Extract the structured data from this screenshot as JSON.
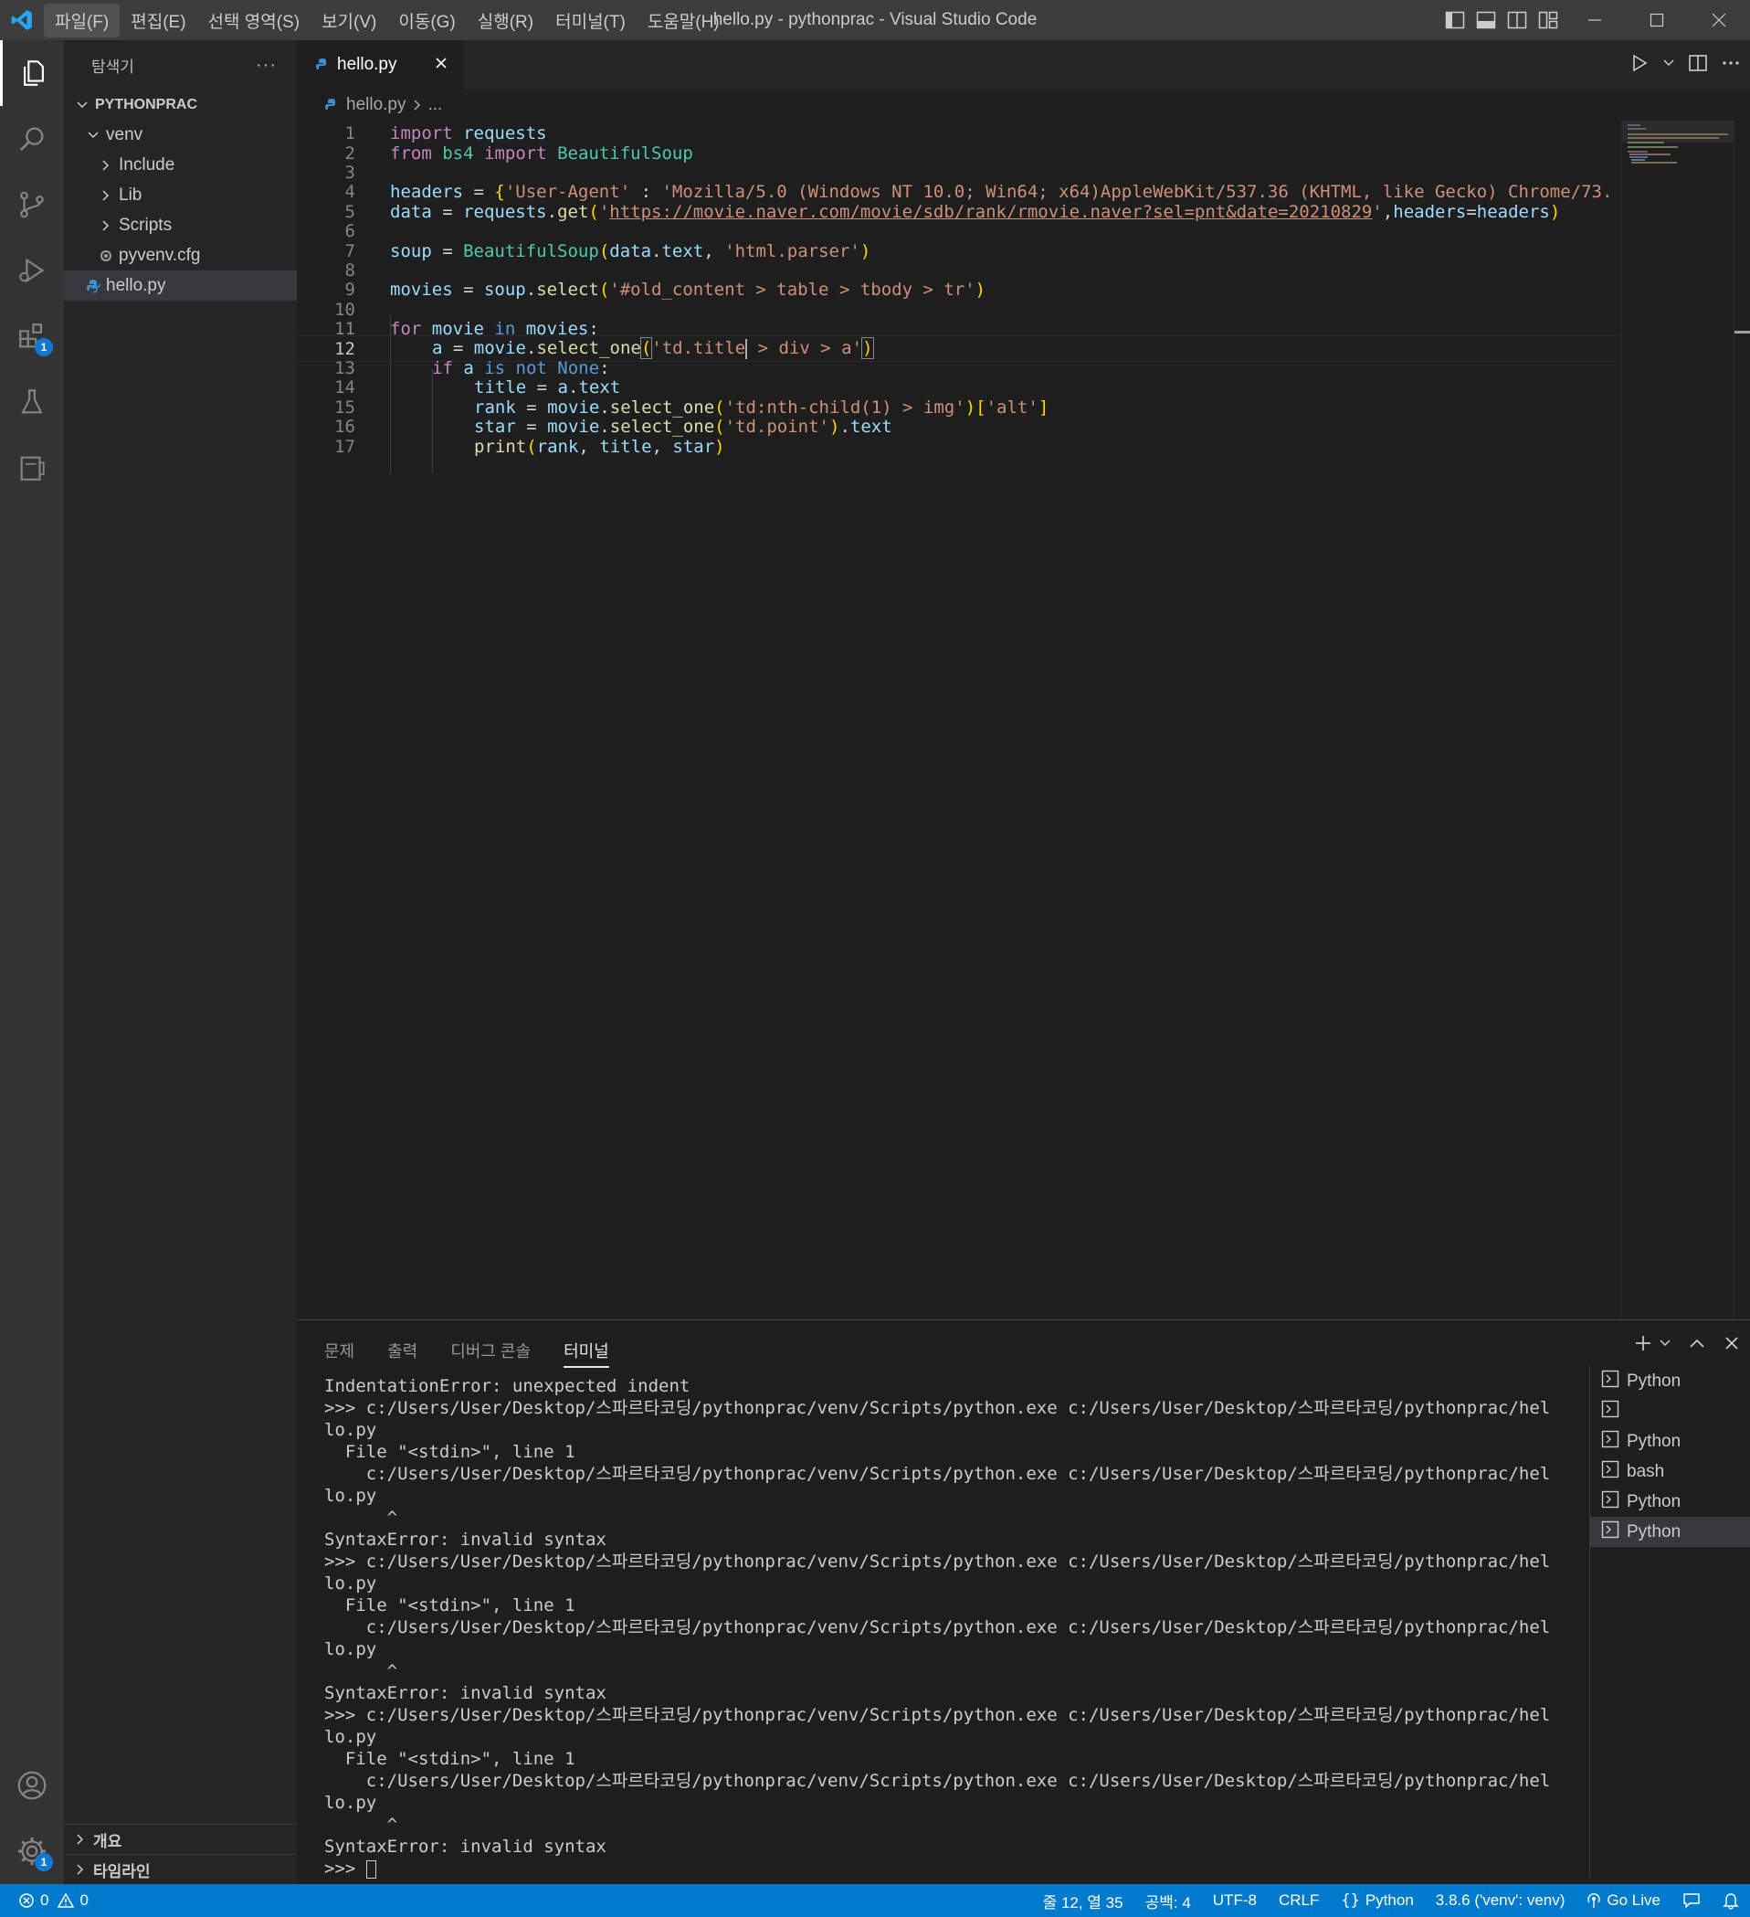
{
  "window": {
    "title": "hello.py - pythonprac - Visual Studio Code",
    "menu": [
      "파일(F)",
      "편집(E)",
      "선택 영역(S)",
      "보기(V)",
      "이동(G)",
      "실행(R)",
      "터미널(T)",
      "도움말(H)"
    ]
  },
  "activity_bar": {
    "extensions_badge": "1",
    "settings_badge": "1"
  },
  "sidebar": {
    "title": "탐색기",
    "more": "···",
    "project": "PYTHONPRAC",
    "items": [
      {
        "label": "venv"
      },
      {
        "label": "Include"
      },
      {
        "label": "Lib"
      },
      {
        "label": "Scripts"
      },
      {
        "label": "pyvenv.cfg"
      },
      {
        "label": "hello.py"
      }
    ],
    "outline": "개요",
    "timeline": "타임라인"
  },
  "editor": {
    "tab_label": "hello.py",
    "breadcrumb_file": "hello.py",
    "breadcrumb_rest": "...",
    "line_numbers": [
      "1",
      "2",
      "3",
      "4",
      "5",
      "6",
      "7",
      "8",
      "9",
      "10",
      "11",
      "12",
      "13",
      "14",
      "15",
      "16",
      "17"
    ],
    "lines": {
      "l1_a": "import",
      "l1_b": "requests",
      "l2_a": "from",
      "l2_b": "bs4",
      "l2_c": "import",
      "l2_d": "BeautifulSoup",
      "l4_a": "headers",
      "l4_b": " = ",
      "l4_c": "{",
      "l4_d": "'User-Agent'",
      "l4_e": " : ",
      "l4_f": "'Mozilla/5.0 (Windows NT 10.0; Win64; x64)AppleWebKit/537.36 (KHTML, like Gecko) Chrome/73.",
      "l5_a": "data",
      "l5_b": " = ",
      "l5_c": "requests",
      "l5_d": ".",
      "l5_e": "get",
      "l5_f": "(",
      "l5_g": "'",
      "l5_h": "https://movie.naver.com/movie/sdb/rank/rmovie.naver?sel=pnt&date=20210829",
      "l5_i": "'",
      "l5_j": ",",
      "l5_k": "headers",
      "l5_l": "=",
      "l5_m": "headers",
      "l5_n": ")",
      "l7_a": "soup",
      "l7_b": " = ",
      "l7_c": "BeautifulSoup",
      "l7_d": "(",
      "l7_e": "data",
      "l7_f": ".",
      "l7_g": "text",
      "l7_h": ", ",
      "l7_i": "'html.parser'",
      "l7_j": ")",
      "l9_a": "movies",
      "l9_b": " = ",
      "l9_c": "soup",
      "l9_d": ".",
      "l9_e": "select",
      "l9_f": "(",
      "l9_g": "'#old_content > table > tbody > tr'",
      "l9_h": ")",
      "l11_a": "for",
      "l11_b": " movie ",
      "l11_c": "in",
      "l11_d": " movies",
      "l11_e": ":",
      "l12_a": "a",
      "l12_b": " = ",
      "l12_c": "movie",
      "l12_d": ".",
      "l12_e": "select_one",
      "l12_f": "(",
      "l12_g": "'td.title",
      "l12_h": " > div > a'",
      "l12_i": ")",
      "l13_a": "if",
      "l13_b": " a ",
      "l13_c": "is not",
      "l13_d": " None",
      "l13_e": ":",
      "l14_a": "title",
      "l14_b": " = ",
      "l14_c": "a",
      "l14_d": ".",
      "l14_e": "text",
      "l15_a": "rank",
      "l15_b": " = ",
      "l15_c": "movie",
      "l15_d": ".",
      "l15_e": "select_one",
      "l15_f": "(",
      "l15_g": "'td:nth-child(1) > img'",
      "l15_h": ")",
      "l15_i": "[",
      "l15_j": "'alt'",
      "l15_k": "]",
      "l16_a": "star",
      "l16_b": " = ",
      "l16_c": "movie",
      "l16_d": ".",
      "l16_e": "select_one",
      "l16_f": "(",
      "l16_g": "'td.point'",
      "l16_h": ")",
      "l16_i": ".",
      "l16_j": "text",
      "l17_a": "print",
      "l17_b": "(",
      "l17_c": "rank",
      "l17_d": ", ",
      "l17_e": "title",
      "l17_f": ", ",
      "l17_g": "star",
      "l17_h": ")"
    }
  },
  "panel": {
    "tabs": [
      "문제",
      "출력",
      "디버그 콘솔",
      "터미널"
    ],
    "terminal_lines": [
      "IndentationError: unexpected indent",
      ">>> c:/Users/User/Desktop/스파르타코딩/pythonprac/venv/Scripts/python.exe c:/Users/User/Desktop/스파르타코딩/pythonprac/hel",
      "lo.py",
      "  File \"<stdin>\", line 1",
      "    c:/Users/User/Desktop/스파르타코딩/pythonprac/venv/Scripts/python.exe c:/Users/User/Desktop/스파르타코딩/pythonprac/hel",
      "lo.py",
      "      ^",
      "SyntaxError: invalid syntax",
      ">>> c:/Users/User/Desktop/스파르타코딩/pythonprac/venv/Scripts/python.exe c:/Users/User/Desktop/스파르타코딩/pythonprac/hel",
      "lo.py",
      "  File \"<stdin>\", line 1",
      "    c:/Users/User/Desktop/스파르타코딩/pythonprac/venv/Scripts/python.exe c:/Users/User/Desktop/스파르타코딩/pythonprac/hel",
      "lo.py",
      "      ^",
      "SyntaxError: invalid syntax",
      ">>> c:/Users/User/Desktop/스파르타코딩/pythonprac/venv/Scripts/python.exe c:/Users/User/Desktop/스파르타코딩/pythonprac/hel",
      "lo.py",
      "  File \"<stdin>\", line 1",
      "    c:/Users/User/Desktop/스파르타코딩/pythonprac/venv/Scripts/python.exe c:/Users/User/Desktop/스파르타코딩/pythonprac/hel",
      "lo.py",
      "      ^",
      "SyntaxError: invalid syntax"
    ],
    "prompt": ">>> ",
    "terminals": [
      "Python",
      "",
      "Python",
      "bash",
      "Python",
      "Python"
    ]
  },
  "statusbar": {
    "errors": "0",
    "warnings": "0",
    "position": "줄 12, 열 35",
    "spaces": "공백: 4",
    "encoding": "UTF-8",
    "eol": "CRLF",
    "language": "Python",
    "interpreter": "3.8.6 ('venv': venv)",
    "golive": "Go Live"
  },
  "colors": {
    "statusbar": "#007acc",
    "accent": "#0e7ad3"
  }
}
